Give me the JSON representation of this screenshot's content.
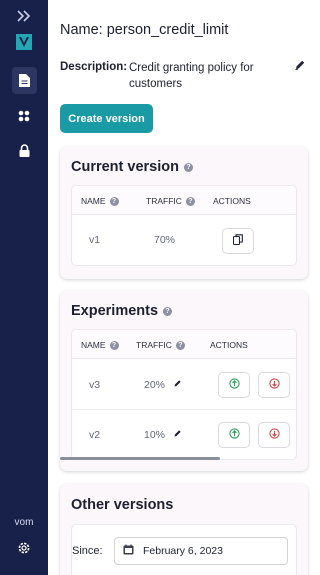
{
  "sidebar": {
    "expand_icon": "double-chevron-right-icon",
    "logo_icon": "v-logo-icon",
    "items": [
      {
        "name": "document-icon",
        "active": true
      },
      {
        "name": "apps-icon",
        "active": false
      },
      {
        "name": "lock-icon",
        "active": false
      }
    ],
    "user_label": "vom",
    "settings_icon": "gear-icon"
  },
  "header": {
    "name_line": "Name: person_credit_limit",
    "description_label": "Description:",
    "description_text": "Credit granting policy for customers",
    "edit_icon": "pencil-icon"
  },
  "create_version_label": "Create version",
  "current_version": {
    "title": "Current version",
    "columns": {
      "name": "NAME",
      "traffic": "TRAFFIC",
      "actions": "ACTIONS"
    },
    "rows": [
      {
        "name": "v1",
        "traffic": "70%",
        "action_icon": "copy-icon"
      }
    ]
  },
  "experiments": {
    "title": "Experiments",
    "columns": {
      "name": "NAME",
      "traffic": "TRAFFIC",
      "actions": "ACTIONS"
    },
    "rows": [
      {
        "name": "v3",
        "traffic": "20%",
        "promote_icon": "arrow-up-circle-icon",
        "demote_icon": "arrow-down-circle-icon"
      },
      {
        "name": "v2",
        "traffic": "10%",
        "promote_icon": "arrow-up-circle-icon",
        "demote_icon": "arrow-down-circle-icon"
      }
    ]
  },
  "other_versions": {
    "title": "Other versions",
    "since_label": "Since:",
    "since_date": "February 6, 2023",
    "calendar_icon": "calendar-icon"
  },
  "colors": {
    "sidebar_bg": "#18214a",
    "primary": "#1a9aa5",
    "promote": "#2e9e5b",
    "demote": "#d04848"
  }
}
